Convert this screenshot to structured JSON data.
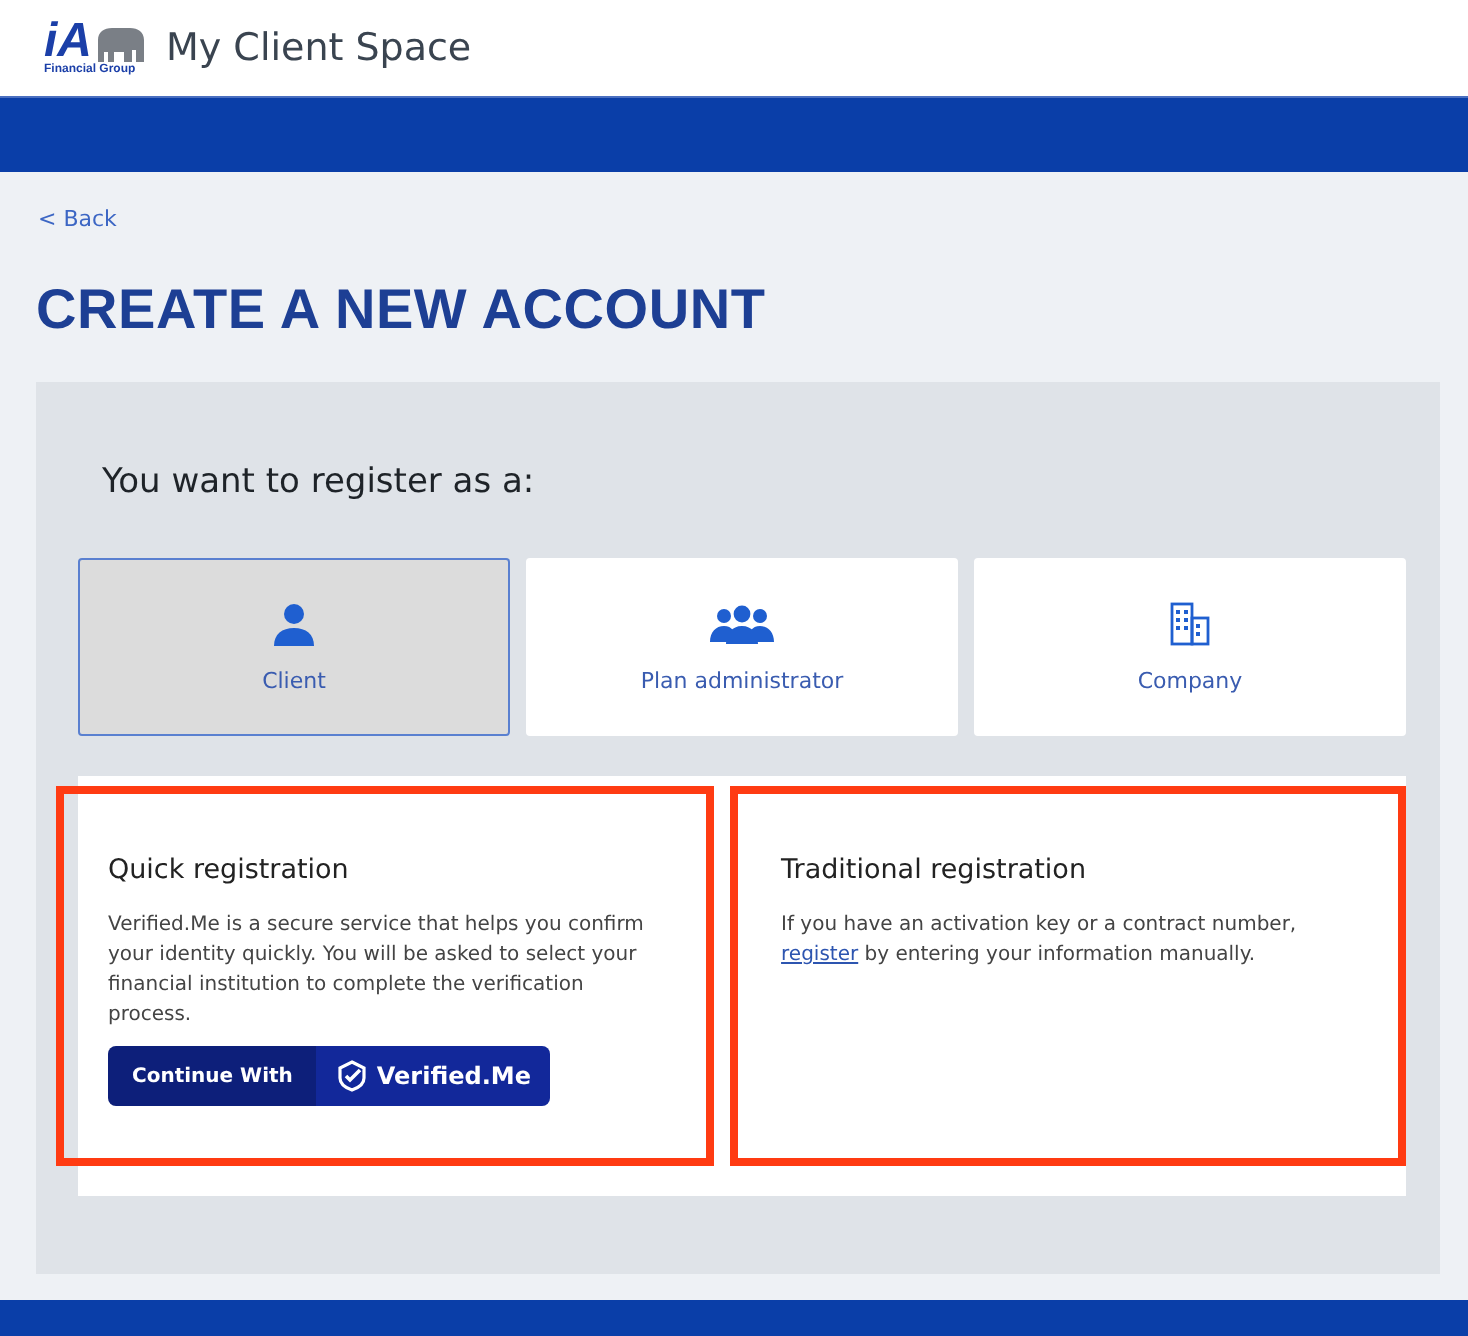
{
  "header": {
    "logo_text": "iA",
    "logo_subtext": "Financial Group",
    "title": "My Client Space"
  },
  "back_link": "< Back",
  "page_title": "CREATE A NEW ACCOUNT",
  "register_prompt": "You want to register as a:",
  "account_types": [
    {
      "label": "Client",
      "kind": "person",
      "selected": true
    },
    {
      "label": "Plan administrator",
      "kind": "group",
      "selected": false
    },
    {
      "label": "Company",
      "kind": "building",
      "selected": false
    }
  ],
  "sections": [
    {
      "kind": "quick",
      "title": "Quick registration",
      "highlighted": true,
      "text": "Verified.Me is a secure service that helps you confirm your identity quickly. You will be asked to select your financial institution to complete the verification process.",
      "button": {
        "left": "Continue With",
        "right": "Verified.Me"
      }
    },
    {
      "kind": "traditional",
      "title": "Traditional registration",
      "highlighted": true,
      "text_before": "If you have an activation key or a contract number,",
      "link": "register",
      "text_after": "by entering your information manually."
    }
  ]
}
